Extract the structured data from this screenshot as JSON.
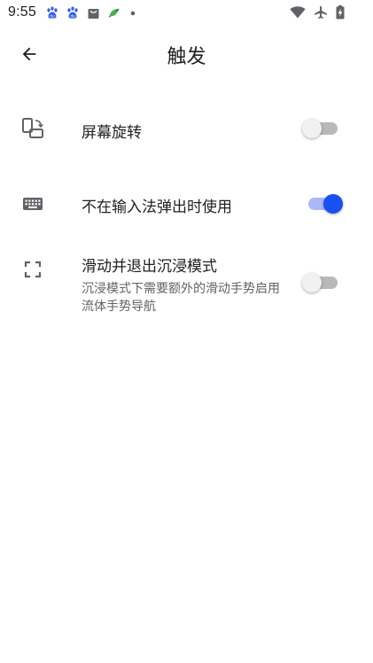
{
  "status_bar": {
    "time": "9:55",
    "left_icons": [
      "baidu-paw-icon",
      "baidu-paw-icon",
      "shopping-bag-icon",
      "bird-app-icon",
      "notification-dot-icon"
    ],
    "right_icons": [
      "wifi-icon",
      "airplane-mode-icon",
      "battery-charging-icon"
    ]
  },
  "app_bar": {
    "back_icon": "arrow-back-icon",
    "title": "触发"
  },
  "settings": [
    {
      "icon": "screen-rotation-icon",
      "title": "屏幕旋转",
      "enabled": false
    },
    {
      "icon": "keyboard-icon",
      "title": "不在输入法弹出时使用",
      "enabled": true
    },
    {
      "icon": "fullscreen-icon",
      "title": "滑动并退出沉浸模式",
      "summary": "沉浸模式下需要额外的滑动手势启用流体手势导航",
      "enabled": false
    }
  ],
  "colors": {
    "switch_on_thumb": "#1a4ff0",
    "switch_on_track": "#aab8f6",
    "switch_off_thumb": "#f1f1f1",
    "switch_off_track": "#b9b9b9",
    "baidu_blue": "#2f5bea"
  }
}
